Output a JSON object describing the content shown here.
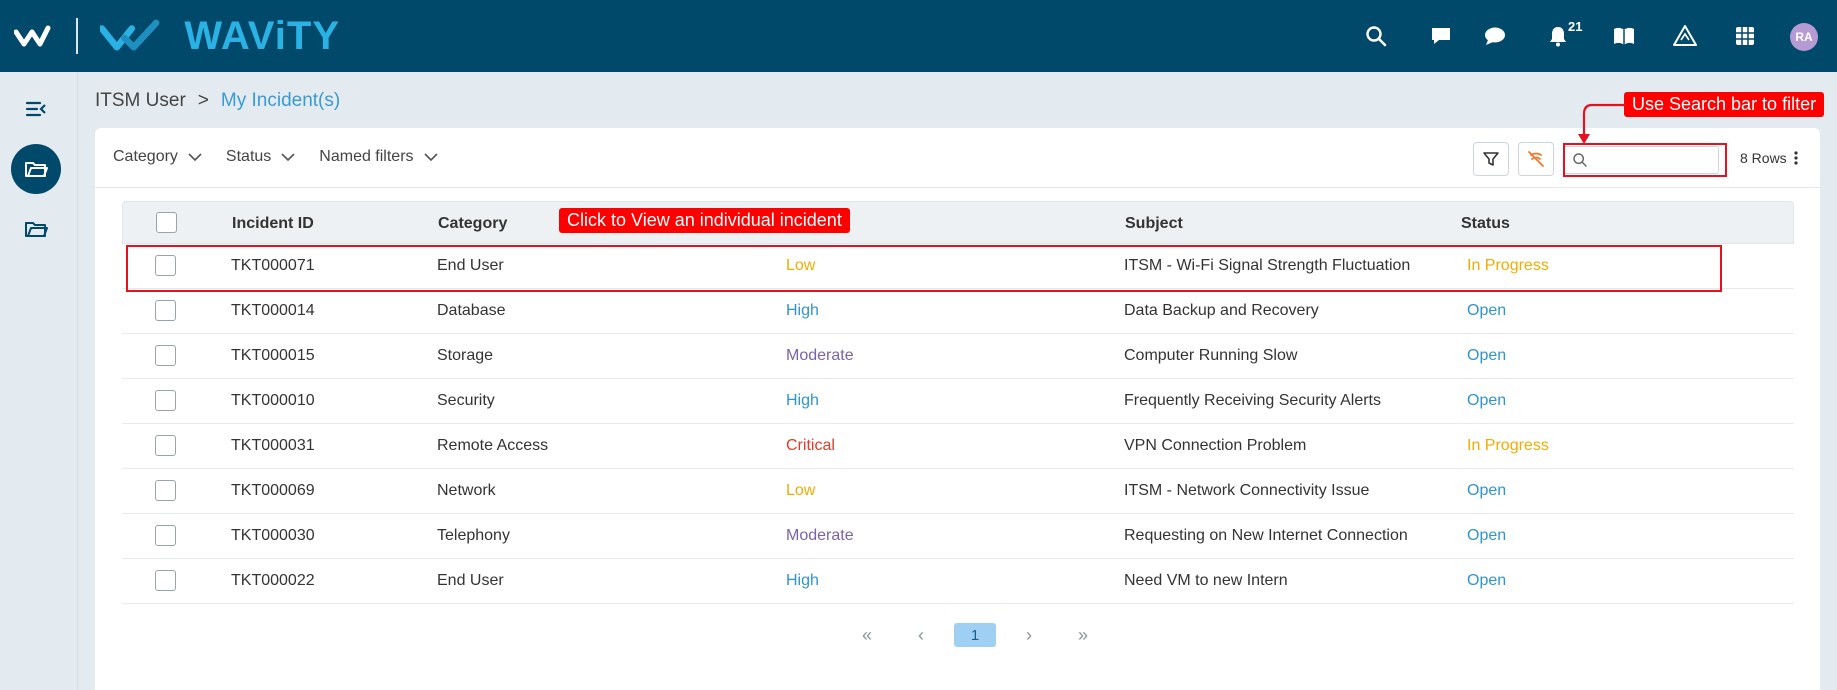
{
  "app": {
    "brand_text": "WAViTY",
    "notifications_count": "21",
    "user_initials": "RA"
  },
  "breadcrumb": {
    "parent": "ITSM User",
    "separator": ">",
    "current": "My Incident(s)"
  },
  "toolbar": {
    "filters": [
      {
        "label": "Category"
      },
      {
        "label": "Status"
      },
      {
        "label": "Named filters"
      }
    ],
    "search_placeholder": "",
    "rows_label": "8 Rows"
  },
  "table": {
    "headers": {
      "id": "Incident ID",
      "category": "Category",
      "subject": "Subject",
      "status": "Status"
    },
    "rows": [
      {
        "id": "TKT000071",
        "category": "End User",
        "priority": "Low",
        "subject": "ITSM - Wi-Fi Signal Strength Fluctuation",
        "status": "In Progress"
      },
      {
        "id": "TKT000014",
        "category": "Database",
        "priority": "High",
        "subject": "Data Backup and Recovery",
        "status": "Open"
      },
      {
        "id": "TKT000015",
        "category": "Storage",
        "priority": "Moderate",
        "subject": "Computer Running Slow",
        "status": "Open"
      },
      {
        "id": "TKT000010",
        "category": "Security",
        "priority": "High",
        "subject": "Frequently Receiving Security Alerts",
        "status": "Open"
      },
      {
        "id": "TKT000031",
        "category": "Remote Access",
        "priority": "Critical",
        "subject": "VPN Connection Problem",
        "status": "In Progress"
      },
      {
        "id": "TKT000069",
        "category": "Network",
        "priority": "Low",
        "subject": "ITSM - Network Connectivity Issue",
        "status": "Open"
      },
      {
        "id": "TKT000030",
        "category": "Telephony",
        "priority": "Moderate",
        "subject": "Requesting on New Internet Connection",
        "status": "Open"
      },
      {
        "id": "TKT000022",
        "category": "End User",
        "priority": "High",
        "subject": "Need VM to new Intern",
        "status": "Open"
      }
    ]
  },
  "pagination": {
    "first": "«",
    "prev": "‹",
    "current": "1",
    "next": "›",
    "last": "»"
  },
  "colors": {
    "Low": "#f0ac00",
    "High": "#2f94cf",
    "Moderate": "#7a63a8",
    "Critical": "#e13b2b",
    "Open": "#2f94cf",
    "In Progress": "#f0ac00",
    "topbar": "#01496a",
    "annotation": "#ff0000"
  },
  "annotations": {
    "search_hint": "Use Search bar to filter",
    "row_hint": "Click to View an individual incident"
  }
}
